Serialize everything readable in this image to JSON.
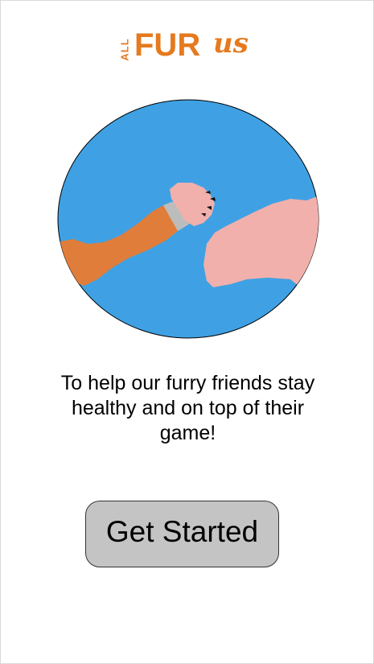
{
  "logo": {
    "prefix": "ALL",
    "main": "FUR",
    "suffix": "us"
  },
  "hero": {
    "icon": "arm-wrestling-illustration"
  },
  "tagline": "To help our furry friends stay healthy and on top of their game!",
  "cta": {
    "label": "Get Started"
  },
  "colors": {
    "brand": "#e57a1e",
    "circle": "#3fa1e3",
    "paw_arm": "#e07d3a",
    "human_arm": "#f1b0ac",
    "wrap": "#bcbcbc",
    "button": "#c4c4c4"
  }
}
